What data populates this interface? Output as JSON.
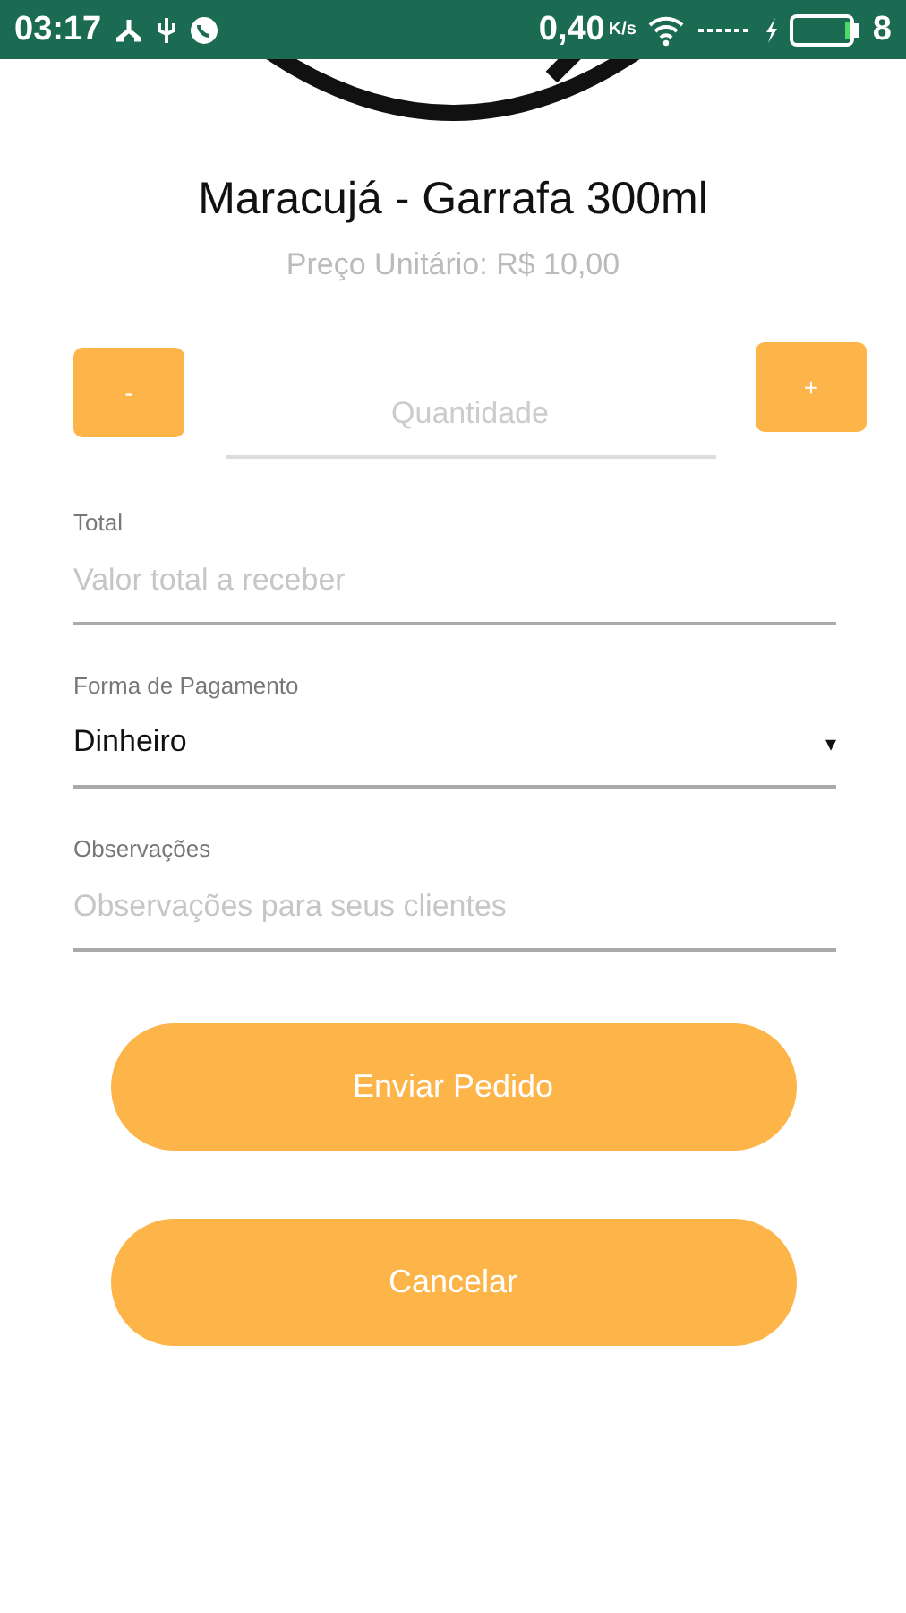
{
  "status_bar": {
    "time": "03:17",
    "speed": "0,40",
    "speed_unit": "K/s",
    "battery": "8"
  },
  "product": {
    "name": "Maracujá - Garrafa 300ml",
    "price": "Preço Unitário: R$ 10,00"
  },
  "quantity": {
    "decrement": "-",
    "placeholder": "Quantidade",
    "increment": "+"
  },
  "fields": [
    {
      "kind": "text",
      "label": "Total",
      "placeholder": "Valor total a receber"
    },
    {
      "kind": "select",
      "label": "Forma de Pagamento",
      "value": "Dinheiro",
      "arrow": "▾"
    },
    {
      "kind": "text",
      "label": "Observações",
      "placeholder": "Observações para seus clientes"
    }
  ],
  "buttons": [
    "Enviar Pedido",
    "Cancelar"
  ]
}
